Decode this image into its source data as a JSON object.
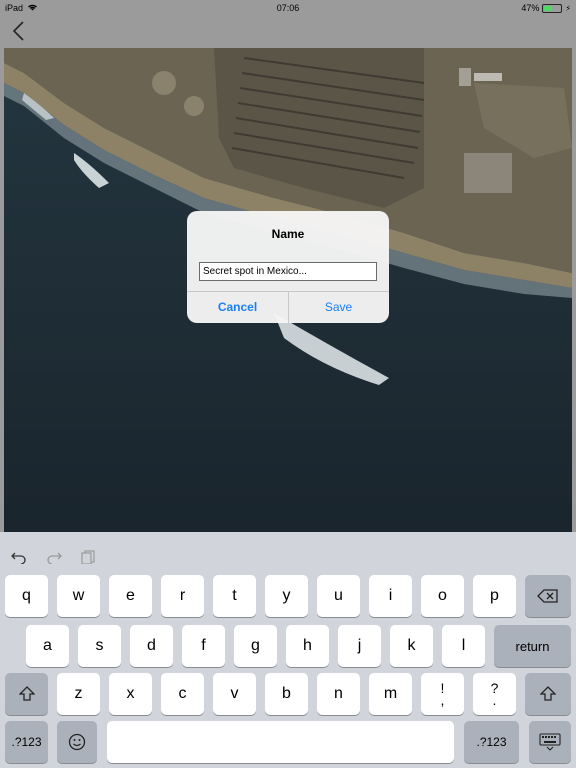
{
  "status_bar": {
    "carrier": "iPad",
    "time": "07:06",
    "battery": "47%",
    "battery_level": 0.47
  },
  "nav": {
    "back_icon": "chevron-left-icon"
  },
  "dialog": {
    "title": "Name",
    "input_value": "Secret spot in Mexico...",
    "cancel_label": "Cancel",
    "save_label": "Save",
    "accent_color": "#1a7ff2"
  },
  "keyboard": {
    "toolbar": [
      "undo-icon",
      "redo-icon",
      "paste-icon"
    ],
    "row1": [
      "q",
      "w",
      "e",
      "r",
      "t",
      "y",
      "u",
      "i",
      "o",
      "p"
    ],
    "row2": [
      "a",
      "s",
      "d",
      "f",
      "g",
      "h",
      "j",
      "k",
      "l"
    ],
    "row3": [
      "z",
      "x",
      "c",
      "v",
      "b",
      "n",
      "m"
    ],
    "return_label": "return",
    "numbers_label": ".?123",
    "exclaim_top": "!",
    "exclaim_bottom": ",",
    "question_top": "?",
    "question_bottom": "."
  }
}
